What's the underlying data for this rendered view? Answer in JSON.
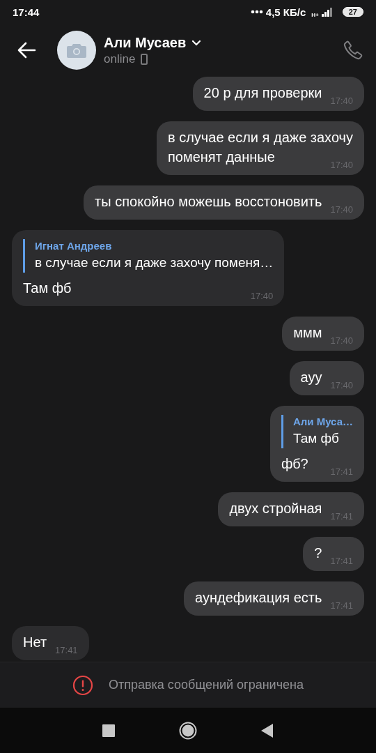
{
  "status_bar": {
    "time": "17:44",
    "network_speed": "4,5 КБ/с",
    "network_type": "H+",
    "battery": "27"
  },
  "header": {
    "name": "Али Мусаев",
    "status": "online"
  },
  "messages": [
    {
      "kind": "text",
      "outgoing": true,
      "text": "20 р для проверки",
      "time": "17:40"
    },
    {
      "kind": "text",
      "outgoing": true,
      "text": "в случае если я даже захочу\nпоменят данные",
      "time": "17:40"
    },
    {
      "kind": "text",
      "outgoing": true,
      "text": "ты спокойно можешь восстоновить",
      "time": "17:40"
    },
    {
      "kind": "reply",
      "outgoing": false,
      "reply_author": "Игнат Андреев",
      "reply_text": "в случае если я даже захочу поменя…",
      "text": "Там фб",
      "time": "17:40"
    },
    {
      "kind": "text",
      "outgoing": true,
      "text": "ммм",
      "time": "17:40"
    },
    {
      "kind": "text",
      "outgoing": true,
      "text": "ауу",
      "time": "17:40"
    },
    {
      "kind": "reply",
      "outgoing": true,
      "reply_author": "Али Муса…",
      "reply_text": "Там фб",
      "text": "фб?",
      "time": "17:41"
    },
    {
      "kind": "text",
      "outgoing": true,
      "text": "двух стройная",
      "time": "17:41"
    },
    {
      "kind": "text",
      "outgoing": true,
      "text": "?",
      "time": "17:41"
    },
    {
      "kind": "text",
      "outgoing": true,
      "text": "аундефикация есть",
      "time": "17:41"
    },
    {
      "kind": "text",
      "outgoing": false,
      "text": "Нет",
      "time": "17:41"
    }
  ],
  "notice": "Отправка сообщений ограничена"
}
